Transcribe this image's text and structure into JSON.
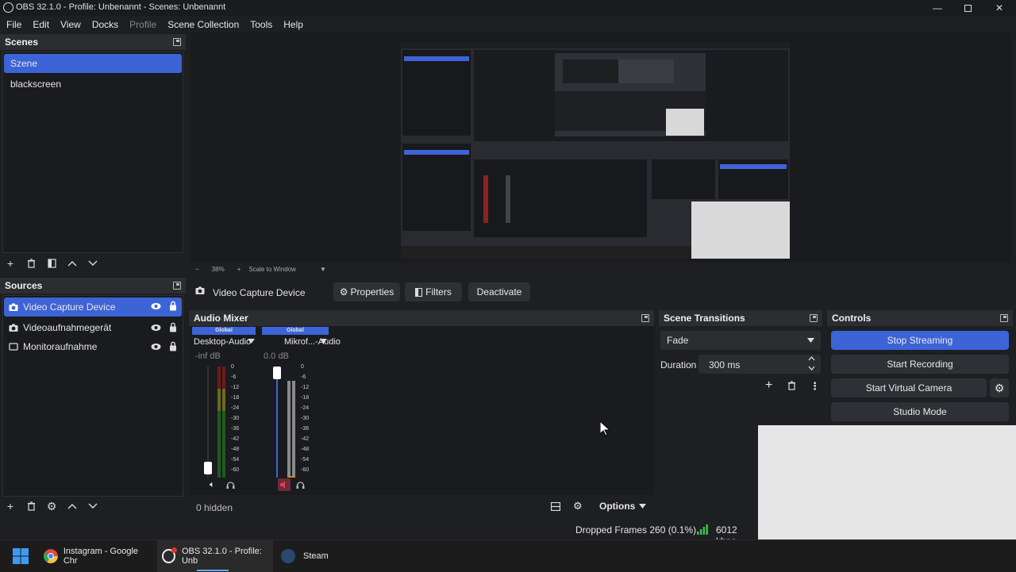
{
  "window": {
    "title": "OBS 32.1.0 - Profile: Unbenannt - Scenes: Unbenannt"
  },
  "menu": [
    "File",
    "Edit",
    "View",
    "Docks",
    "Profile",
    "Scene Collection",
    "Tools",
    "Help"
  ],
  "scenes": {
    "title": "Scenes",
    "items": [
      "Szene",
      "blackscreen"
    ],
    "selected": "Szene"
  },
  "preview": {
    "zoom": "38%",
    "scale_mode": "Scale to Window"
  },
  "sources": {
    "title": "Sources",
    "items": [
      "Video Capture Device",
      "Videoaufnahmegerät",
      "Monitoraufnahme"
    ]
  },
  "source_toolbar": {
    "selected_source": "Video Capture Device",
    "properties": "Properties",
    "filters": "Filters",
    "deactivate": "Deactivate"
  },
  "audio_mixer": {
    "title": "Audio Mixer",
    "channels": [
      {
        "badge": "Global",
        "name": "Desktop-Audio",
        "level": "-inf dB",
        "muted": false
      },
      {
        "badge": "Global",
        "name": "Mikrof...-Audio",
        "level": "0.0 dB",
        "muted": true
      }
    ],
    "scale": [
      "0",
      "-6",
      "-12",
      "-18",
      "-24",
      "-30",
      "-36",
      "-42",
      "-48",
      "-54",
      "-60"
    ],
    "hidden": "0 hidden",
    "options": "Options"
  },
  "scene_transitions": {
    "title": "Scene Transitions",
    "transition": "Fade",
    "duration_label": "Duration",
    "duration": "300 ms"
  },
  "controls": {
    "title": "Controls",
    "stop_streaming": "Stop Streaming",
    "start_recording": "Start Recording",
    "start_virtual_camera": "Start Virtual Camera",
    "studio_mode": "Studio Mode"
  },
  "status": {
    "dropped_frames": "Dropped Frames 260 (0.1%)",
    "bitrate": "6012 kbps"
  },
  "taskbar": {
    "items": [
      "Instagram - Google Chr",
      "OBS 32.1.0 - Profile: Unb",
      "Steam"
    ]
  },
  "colors": {
    "accent": "#3c64d6",
    "background": "#1e1f22",
    "panel_header": "#2b2d31"
  }
}
